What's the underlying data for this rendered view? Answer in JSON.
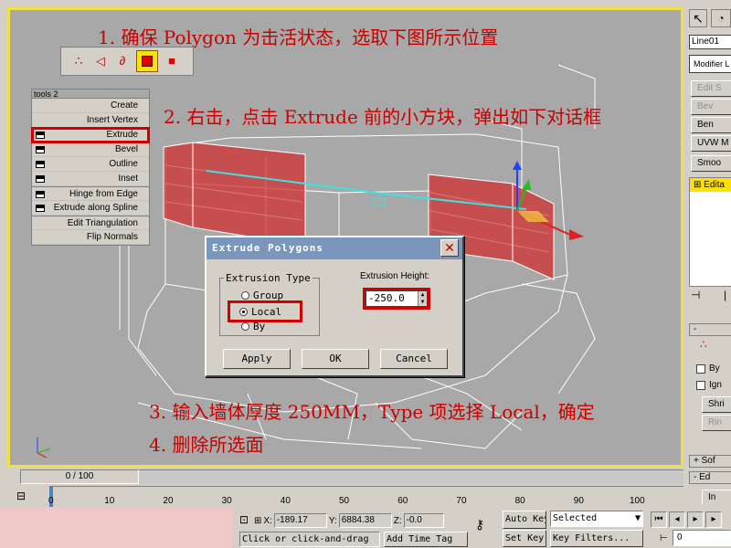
{
  "annotations": {
    "step1": "1. 确保 Polygon 为击活状态，选取下图所示位置",
    "step2": "2. 右击，点击 Extrude 前的小方块，弹出如下对话框",
    "step3": "3. 输入墙体厚度 250MM，Type 项选择 Local，确定",
    "step4": "4. 删除所选面"
  },
  "subobject_toolbar": {
    "icons": [
      "vertex-icon",
      "edge-icon",
      "border-icon",
      "polygon-icon",
      "element-icon"
    ],
    "active": "polygon-icon"
  },
  "quad_menu": {
    "title": "tools 2",
    "items": [
      {
        "label": "Create",
        "icon": false
      },
      {
        "label": "Insert Vertex",
        "icon": false
      },
      {
        "label": "Extrude",
        "icon": true
      },
      {
        "label": "Bevel",
        "icon": true
      },
      {
        "label": "Outline",
        "icon": true
      },
      {
        "label": "Inset",
        "icon": true
      },
      {
        "label": "Hinge from Edge",
        "icon": true
      },
      {
        "label": "Extrude along Spline",
        "icon": true
      },
      {
        "label": "Edit Triangulation",
        "icon": false
      },
      {
        "label": "Flip Normals",
        "icon": false
      }
    ]
  },
  "dialog": {
    "title": "Extrude Polygons",
    "close_label": "✕",
    "type_legend": "Extrusion Type",
    "options": [
      "Group",
      "Local",
      "By"
    ],
    "selected_option": "Local",
    "height_label": "Extrusion Height:",
    "height_value": "-250.0",
    "buttons": {
      "apply": "Apply",
      "ok": "OK",
      "cancel": "Cancel"
    }
  },
  "right_panel": {
    "object_name": "Line01",
    "modifier_list": "Modifier L",
    "buttons": [
      "Edit S",
      "Bev",
      "Ben",
      "UVW M",
      "Smoo"
    ],
    "stack_item": "Edita",
    "checkbox_by": "By",
    "checkbox_ign": "Ign",
    "shrink": "Shri",
    "ring": "Rin",
    "soft": "Sof",
    "edit": "Ed",
    "in": "In"
  },
  "timeline": {
    "slider_label": "0 / 100",
    "ticks": [
      "0",
      "10",
      "20",
      "30",
      "40",
      "50",
      "60",
      "70",
      "80",
      "90",
      "100"
    ]
  },
  "status": {
    "x_label": "X:",
    "x_value": "-189.17",
    "y_label": "Y:",
    "y_value": "6884.38",
    "z_label": "Z:",
    "z_value": "-0.0",
    "prompt": "Click or click-and-drag",
    "add_time_tag": "Add Time Tag",
    "auto_key": "Auto Key",
    "set_key": "Set Key",
    "selected": "Selected",
    "key_filters": "Key Filters...",
    "frame": "0"
  },
  "colors": {
    "annotation": "#c80000",
    "highlight": "#d00000",
    "viewport_border": "#f0e040",
    "selected_polygon": "#d03030"
  }
}
